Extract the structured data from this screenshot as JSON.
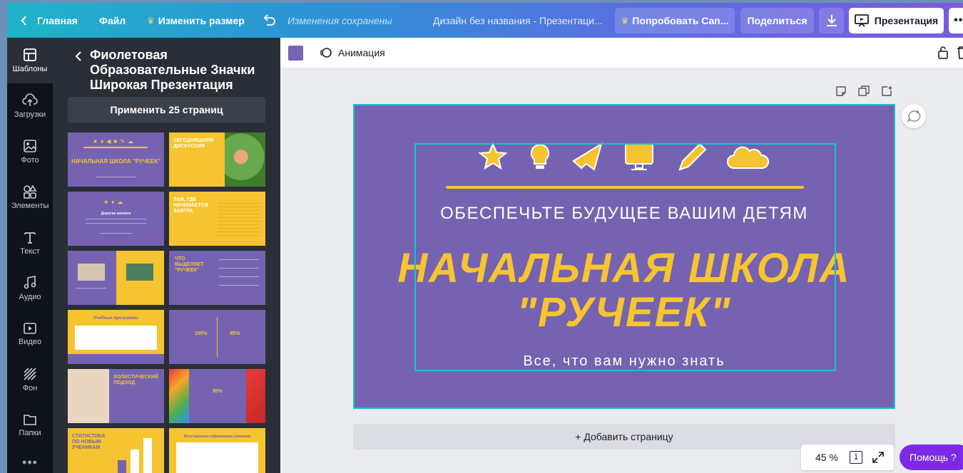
{
  "topbar": {
    "home": "Главная",
    "file": "Файл",
    "resize": "Изменить размер",
    "saved_status": "Изменения сохранены",
    "doc_title": "Дизайн без названия - Презентаци...",
    "try_pro": "Попробовать Can...",
    "share": "Поделиться",
    "present": "Презентация"
  },
  "rail": {
    "items": [
      {
        "label": "Шаблоны",
        "icon": "templates-icon"
      },
      {
        "label": "Загрузки",
        "icon": "upload-icon"
      },
      {
        "label": "Фото",
        "icon": "photo-icon"
      },
      {
        "label": "Элементы",
        "icon": "elements-icon"
      },
      {
        "label": "Текст",
        "icon": "text-icon"
      },
      {
        "label": "Аудио",
        "icon": "audio-icon"
      },
      {
        "label": "Видео",
        "icon": "video-icon"
      },
      {
        "label": "Фон",
        "icon": "background-icon"
      },
      {
        "label": "Папки",
        "icon": "folder-icon"
      }
    ]
  },
  "panel": {
    "title": "Фиолетовая Образовательные Значки Широкая Презентация",
    "apply_button": "Применить 25 страниц",
    "thumbs": [
      {
        "title": "НАЧАЛЬНАЯ ШКОЛА \"РУЧЕЕК\""
      },
      {
        "title": "СЕГОДНЯШНЯЯ ДИСКУССИЯ"
      },
      {
        "title": "Дорогие коллеги"
      },
      {
        "title": "ТАМ, ГДЕ НАЧИНАЕТСЯ ЗАВТРА"
      },
      {
        "title": ""
      },
      {
        "title": "ЧТО ВЫДЕЛЯЕТ \"РУЧЕЕК\""
      },
      {
        "title": "Учебные программы"
      },
      {
        "title": "100%  85%"
      },
      {
        "title": "ХОЛИСТИЧЕСКИЙ ПОДХОД"
      },
      {
        "title": "90%"
      },
      {
        "title": "СТАТИСТИКА ПО НОВЫМ УЧЕНИКАМ"
      },
      {
        "title": "Всестороннее образование учеников"
      }
    ]
  },
  "editor": {
    "color_swatch": "#7864b2",
    "animation": "Анимация"
  },
  "slide": {
    "background": "#7563b1",
    "accent": "#f5c430",
    "subtitle": "ОБЕСПЕЧЬТЕ БУДУЩЕЕ ВАШИМ ДЕТЯМ",
    "title_line1": "НАЧАЛЬНАЯ ШКОЛА",
    "title_line2": "\"РУЧЕЕК\"",
    "footer": "Все, что вам нужно знать",
    "icons": [
      "star-icon",
      "lightbulb-icon",
      "paper-plane-icon",
      "monitor-icon",
      "pencil-icon",
      "cloud-icon"
    ]
  },
  "bottom": {
    "add_page": "+ Добавить страницу",
    "zoom": "45 %",
    "page_count": "1",
    "help": "Помощь  ?"
  }
}
